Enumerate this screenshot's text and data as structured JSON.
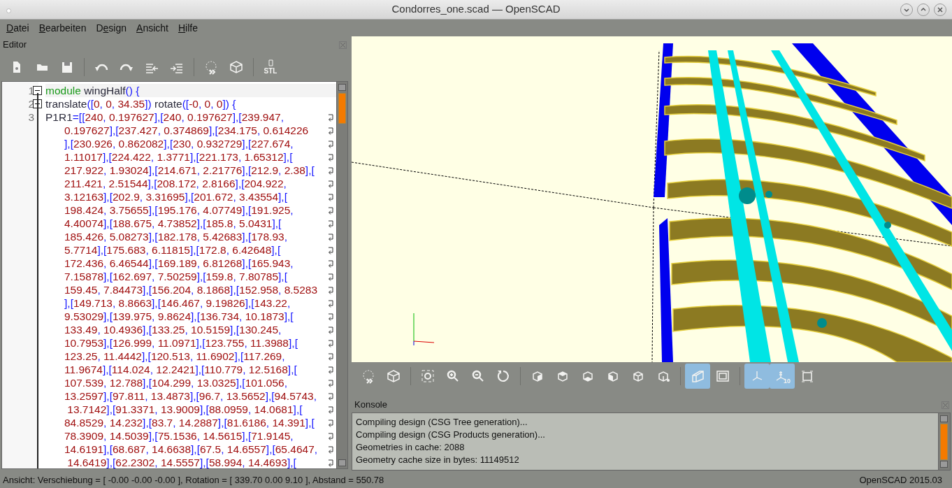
{
  "window": {
    "title": "Condorres_one.scad — OpenSCAD"
  },
  "menu": [
    {
      "mnemonic": "D",
      "rest": "atei"
    },
    {
      "mnemonic": "B",
      "rest": "earbeiten"
    },
    {
      "prefix": "D",
      "mnemonic": "e",
      "rest": "sign"
    },
    {
      "mnemonic": "A",
      "rest": "nsicht"
    },
    {
      "mnemonic": "H",
      "rest": "ilfe"
    }
  ],
  "editor": {
    "title": "Editor",
    "toolbar": [
      [
        {
          "kind": "new"
        },
        {
          "kind": "open"
        },
        {
          "kind": "save"
        }
      ],
      [
        {
          "kind": "undo"
        },
        {
          "kind": "redo"
        },
        {
          "kind": "unindent"
        },
        {
          "kind": "indent"
        }
      ],
      [
        {
          "kind": "preview"
        },
        {
          "kind": "render"
        }
      ],
      [
        {
          "kind": "export",
          "label": "STL"
        }
      ]
    ],
    "lines": [
      {
        "number": "1",
        "fold": true,
        "keyword": "module",
        "wrapped": false,
        "rows": [
          " wingHalf() {"
        ]
      },
      {
        "number": "2",
        "fold": true,
        "wrapped": false,
        "rows": [
          "translate([0, 0, 34.35]) rotate([-0, 0, 0]) {"
        ]
      },
      {
        "number": "3",
        "fold": false,
        "wrapped": true,
        "rows": [
          "P1R1=[[240, 0.197627],[240, 0.197627],[239.947,",
          "0.197627],[237.427, 0.374869],[234.175, 0.614226",
          "],[230.926, 0.862082],[230, 0.932729],[227.674,",
          "1.11017],[224.422, 1.3771],[221.173, 1.65312],[",
          "217.922, 1.93024],[214.671, 2.21776],[212.9, 2.38],[",
          "211.421, 2.51544],[208.172, 2.8166],[204.922,",
          "3.12163],[202.9, 3.31695],[201.672, 3.43554],[",
          "198.424, 3.75655],[195.176, 4.07749],[191.925,",
          "4.40074],[188.675, 4.73852],[185.8, 5.0431],[",
          "185.426, 5.08273],[182.178, 5.42683],[178.93,",
          "5.7714],[175.683, 6.11815],[172.8, 6.42648],[",
          "172.436, 6.46544],[169.189, 6.81268],[165.943,",
          "7.15878],[162.697, 7.50259],[159.8, 7.80785],[",
          "159.45, 7.84473],[156.204, 8.1868],[152.958, 8.5283",
          "],[149.713, 8.8663],[146.467, 9.19826],[143.22,",
          "9.53029],[139.975, 9.8624],[136.734, 10.1873],[",
          "133.49, 10.4936],[133.25, 10.5159],[130.245,",
          "10.7953],[126.999, 11.0971],[123.755, 11.3988],[",
          "123.25, 11.4442],[120.513, 11.6902],[117.269,",
          "11.9674],[114.024, 12.2421],[110.779, 12.5168],[",
          "107.539, 12.788],[104.299, 13.0325],[101.056,",
          "13.2597],[97.811, 13.4873],[96.7, 13.5652],[94.5743,",
          " 13.7142],[91.3371, 13.9009],[88.0959, 14.0681],[",
          "84.8529, 14.232],[83.7, 14.2887],[81.6186, 14.391],[",
          "78.3909, 14.5039],[75.1536, 14.5615],[71.9145,",
          "14.6191],[68.687, 14.6638],[67.5, 14.6557],[65.4647,",
          " 14.6419],[62.2302, 14.5557],[58.994, 14.4693],["
        ]
      }
    ]
  },
  "viewer": {
    "toolbar": [
      [
        {
          "kind": "preview",
          "active": false
        },
        {
          "kind": "render",
          "active": false
        }
      ],
      [
        {
          "kind": "view-all",
          "active": false
        },
        {
          "kind": "zoom-in",
          "active": false
        },
        {
          "kind": "zoom-out",
          "active": false
        },
        {
          "kind": "reset",
          "active": false
        }
      ],
      [
        {
          "kind": "right",
          "active": false
        },
        {
          "kind": "top",
          "active": false
        },
        {
          "kind": "bottom",
          "active": false
        },
        {
          "kind": "left",
          "active": false
        },
        {
          "kind": "front",
          "active": false
        },
        {
          "kind": "back",
          "active": false
        }
      ],
      [
        {
          "kind": "perspective",
          "active": true
        },
        {
          "kind": "orthogonal",
          "active": false
        }
      ],
      [
        {
          "kind": "axes",
          "active": true
        },
        {
          "kind": "scale",
          "active": true,
          "label": "10"
        },
        {
          "kind": "edges",
          "active": false
        }
      ]
    ]
  },
  "console": {
    "title": "Konsole",
    "lines": [
      "Compiling design (CSG Tree generation)...",
      "Compiling design (CSG Products generation)...",
      "Geometries in cache: 2088",
      "Geometry cache size in bytes: 11149512"
    ]
  },
  "status_bar": {
    "left": "Ansicht: Verschiebung = [ -0.00 -0.00 -0.00 ], Rotation = [ 339.70 0.00 9.10 ], Abstand = 550.78",
    "right": "OpenSCAD 2015.03"
  }
}
